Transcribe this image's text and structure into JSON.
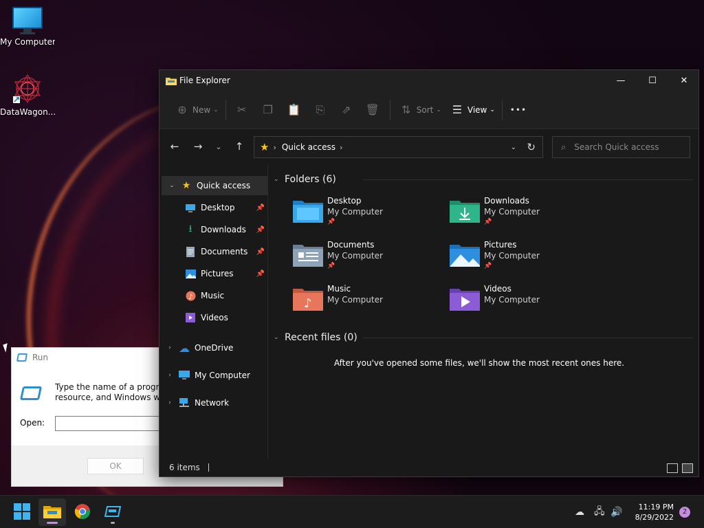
{
  "desktop": {
    "icons": [
      {
        "label": "My Computer",
        "icon": "monitor-icon"
      },
      {
        "label": "DataWagon...",
        "icon": "datawagon-shortcut-icon"
      }
    ]
  },
  "run_dialog": {
    "title": "Run",
    "description_line1": "Type the name of a program,",
    "description_line2": "resource, and Windows will o",
    "open_label": "Open:",
    "open_value": "",
    "ok_label": "OK"
  },
  "explorer": {
    "title": "File Explorer",
    "window_controls": {
      "minimize": "—",
      "maximize": "☐",
      "close": "✕"
    },
    "commands": {
      "new_label": "New",
      "sort_label": "Sort",
      "view_label": "View",
      "more_label": "•••"
    },
    "address": {
      "crumb": "Quick access"
    },
    "search": {
      "placeholder": "Search Quick access"
    },
    "sidebar": {
      "quick_access": "Quick access",
      "items": [
        {
          "label": "Desktop",
          "icon": "desktop-icon",
          "pinned": true
        },
        {
          "label": "Downloads",
          "icon": "download-icon",
          "pinned": true
        },
        {
          "label": "Documents",
          "icon": "documents-icon",
          "pinned": true
        },
        {
          "label": "Pictures",
          "icon": "pictures-icon",
          "pinned": true
        },
        {
          "label": "Music",
          "icon": "music-icon",
          "pinned": false
        },
        {
          "label": "Videos",
          "icon": "videos-icon",
          "pinned": false
        }
      ],
      "roots": [
        {
          "label": "OneDrive",
          "icon": "onedrive-icon"
        },
        {
          "label": "My Computer",
          "icon": "monitor-icon"
        },
        {
          "label": "Network",
          "icon": "network-icon"
        }
      ]
    },
    "folders_header": "Folders (6)",
    "folders": [
      {
        "name": "Desktop",
        "location": "My Computer",
        "pinned": true,
        "color": "#3aa8e8"
      },
      {
        "name": "Downloads",
        "location": "My Computer",
        "pinned": true,
        "color": "#2fb58a"
      },
      {
        "name": "Documents",
        "location": "My Computer",
        "pinned": true,
        "color": "#8ea3b8"
      },
      {
        "name": "Pictures",
        "location": "My Computer",
        "pinned": true,
        "color": "#2e8ee0"
      },
      {
        "name": "Music",
        "location": "My Computer",
        "pinned": false,
        "color": "#e8765a"
      },
      {
        "name": "Videos",
        "location": "My Computer",
        "pinned": false,
        "color": "#8b5cd6"
      }
    ],
    "recent_header": "Recent files (0)",
    "recent_empty": "After you've opened some files, we'll show the most recent ones here.",
    "status": {
      "count": "6 items"
    }
  },
  "taskbar": {
    "apps": [
      "start-icon",
      "file-explorer-icon",
      "chrome-icon",
      "run-icon"
    ],
    "time": "11:19 PM",
    "date": "8/29/2022",
    "notifications": "2"
  }
}
